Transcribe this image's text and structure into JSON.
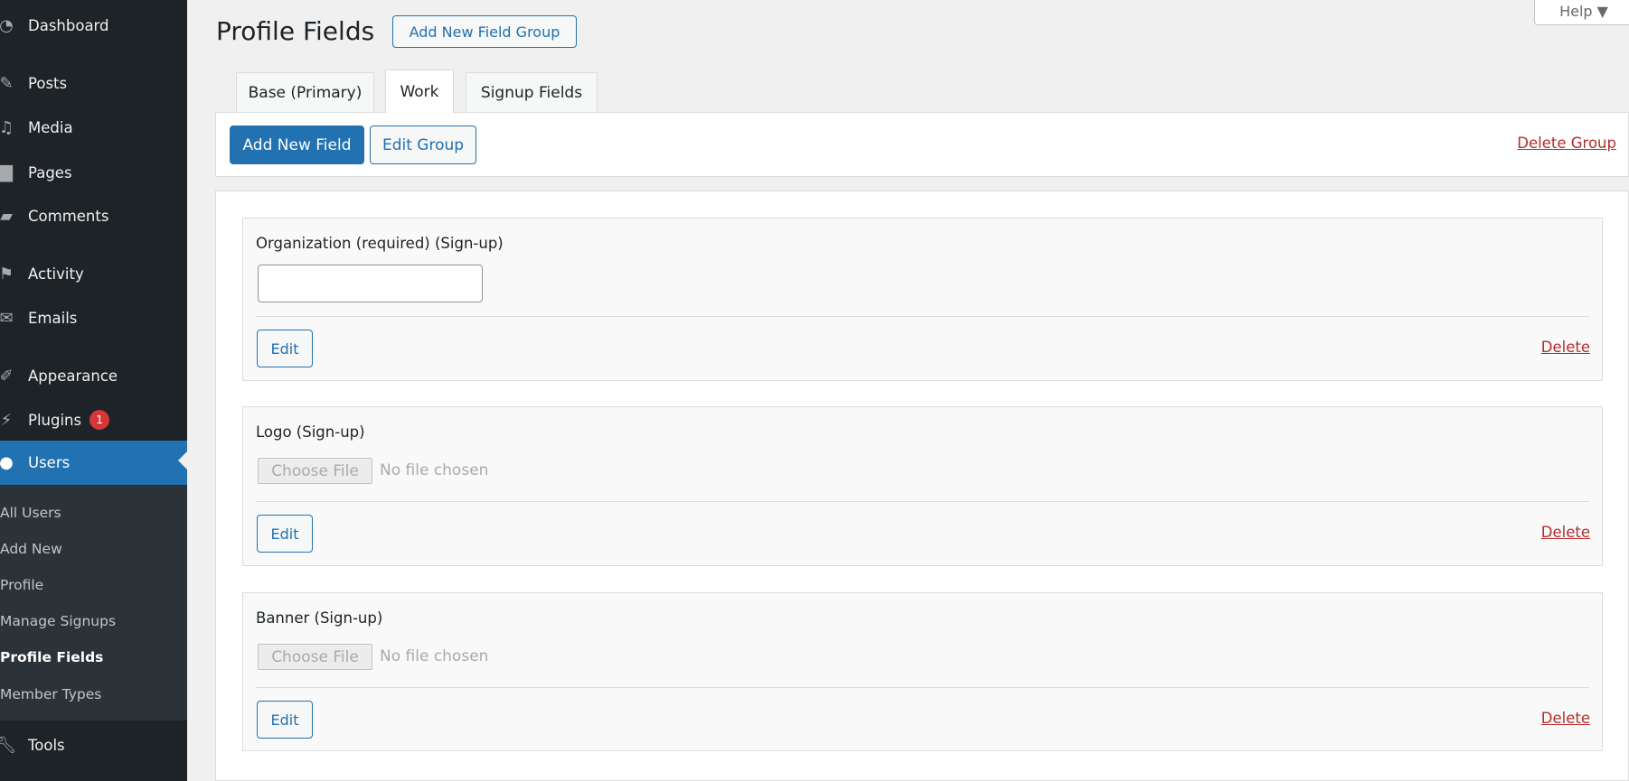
{
  "sidebar": {
    "items": [
      {
        "label": "Dashboard",
        "icon": "dashboard-icon"
      },
      {
        "label": "Posts",
        "icon": "pin-icon"
      },
      {
        "label": "Media",
        "icon": "media-icon"
      },
      {
        "label": "Pages",
        "icon": "page-icon"
      },
      {
        "label": "Comments",
        "icon": "comment-icon"
      },
      {
        "label": "Activity",
        "icon": "activity-icon"
      },
      {
        "label": "Emails",
        "icon": "email-icon"
      },
      {
        "label": "Appearance",
        "icon": "brush-icon"
      },
      {
        "label": "Plugins",
        "icon": "plugin-icon",
        "badge": "1"
      },
      {
        "label": "Users",
        "icon": "user-icon",
        "active": true
      },
      {
        "label": "Tools",
        "icon": "wrench-icon"
      }
    ],
    "submenu": [
      "All Users",
      "Add New",
      "Profile",
      "Manage Signups",
      "Profile Fields",
      "Member Types"
    ],
    "submenu_current": "Profile Fields"
  },
  "help": {
    "label": "Help ▼"
  },
  "header": {
    "title": "Profile Fields",
    "add_group": "Add New Field Group"
  },
  "tabs": [
    "Base (Primary)",
    "Work",
    "Signup Fields"
  ],
  "active_tab": "Work",
  "toolbar": {
    "add_field": "Add New Field",
    "edit_group": "Edit Group",
    "delete_group": "Delete Group"
  },
  "fields": [
    {
      "label": "Organization (required) (Sign-up)",
      "type": "text",
      "value": "",
      "edit": "Edit",
      "delete": "Delete"
    },
    {
      "label": "Logo (Sign-up)",
      "type": "file",
      "choose": "Choose File",
      "status": "No file chosen",
      "edit": "Edit",
      "delete": "Delete"
    },
    {
      "label": "Banner (Sign-up)",
      "type": "file",
      "choose": "Choose File",
      "status": "No file chosen",
      "edit": "Edit",
      "delete": "Delete"
    }
  ],
  "colors": {
    "sidebar": "#1d2327",
    "accent": "#2271b1",
    "danger": "#b32d2e",
    "badge": "#d63638"
  }
}
